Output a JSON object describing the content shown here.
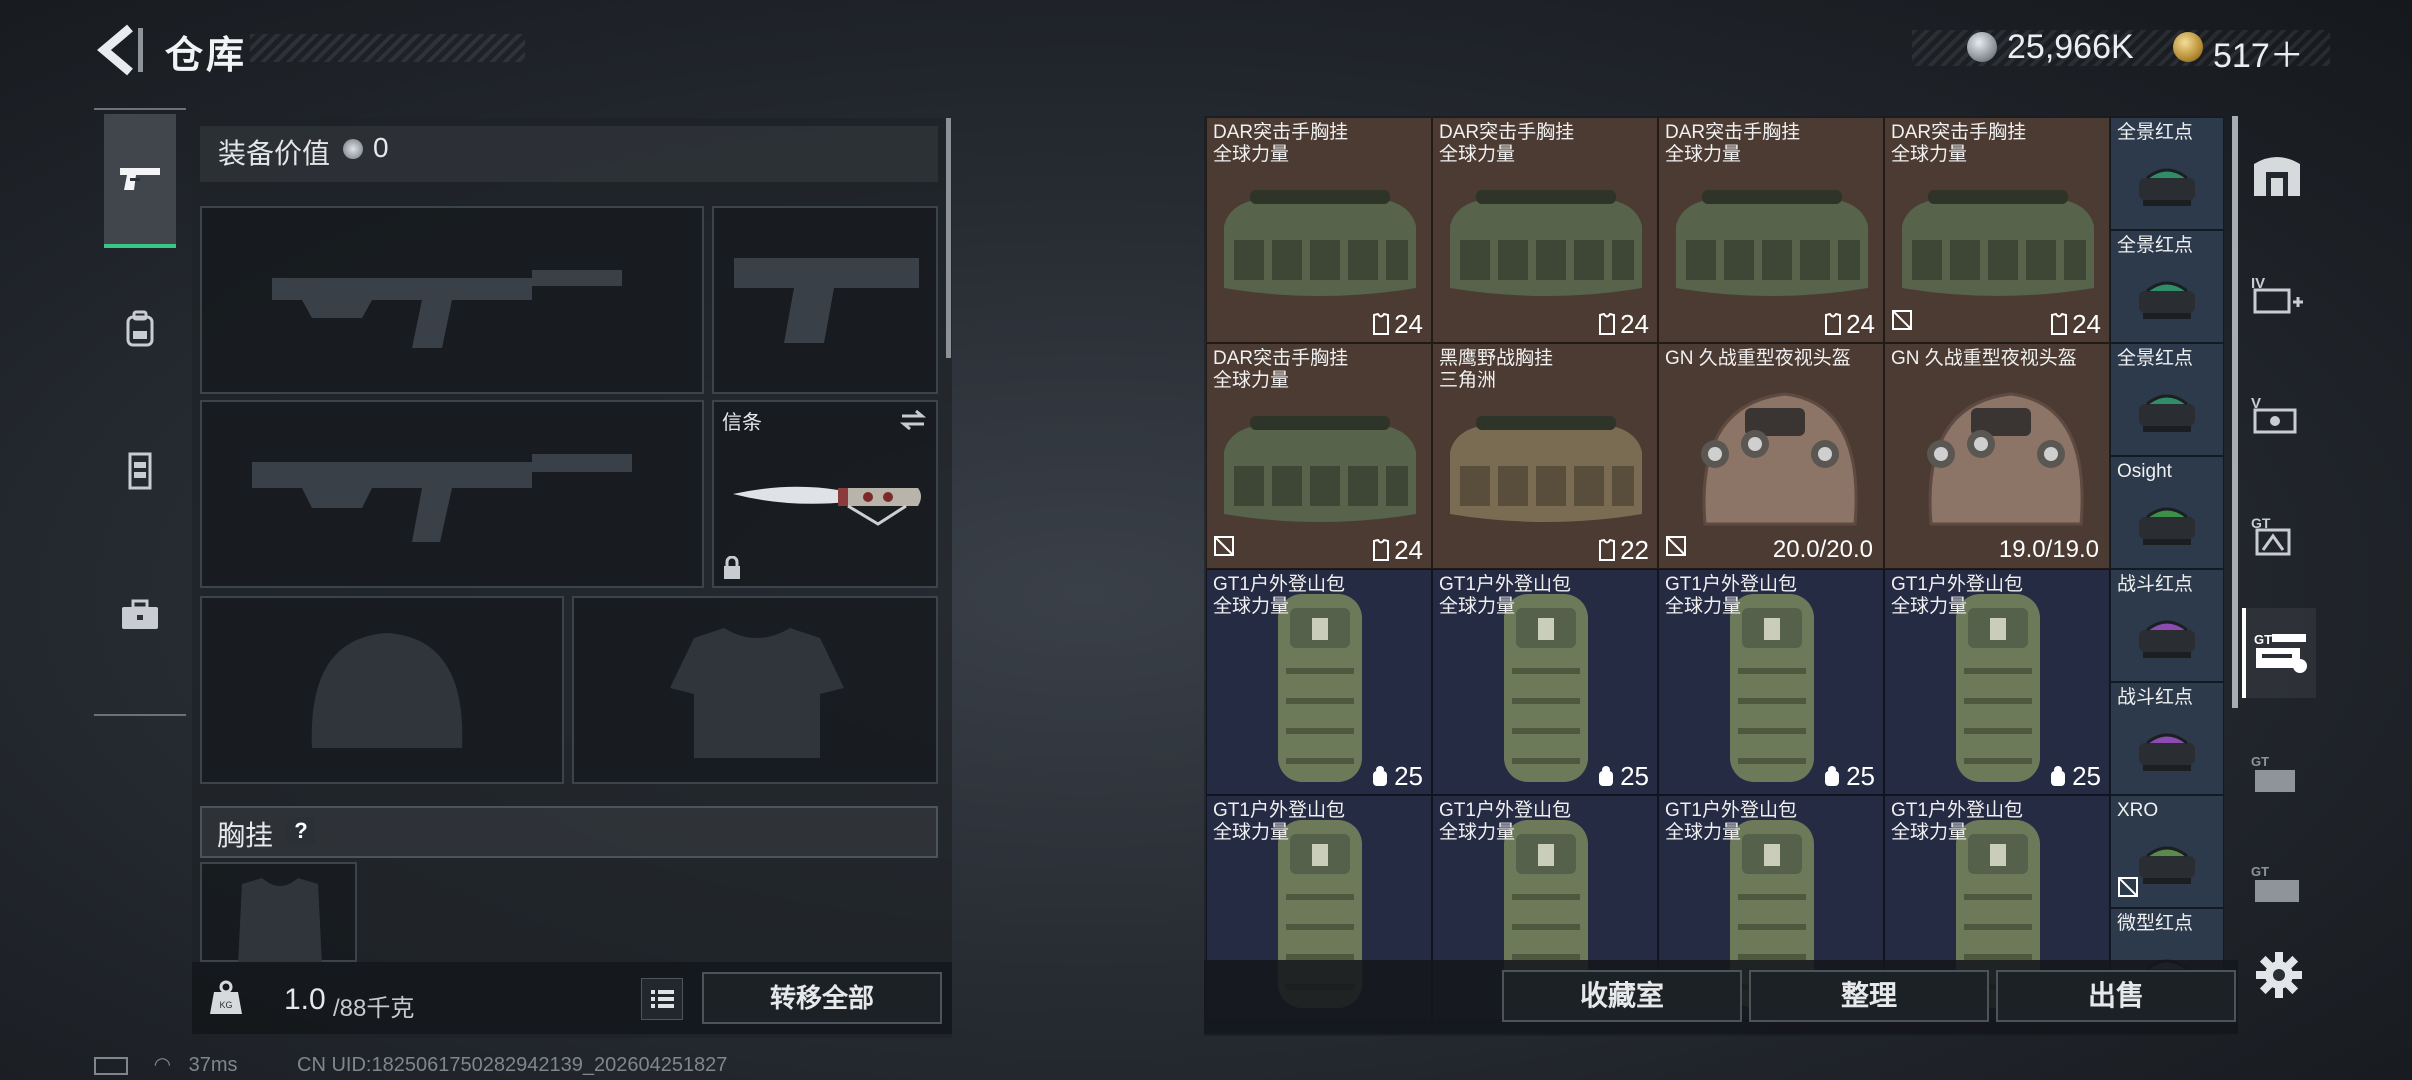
{
  "header": {
    "title": "仓库"
  },
  "currency": {
    "coin": "25,966K",
    "gem": "517＋"
  },
  "left_nav": {
    "items": [
      "weapon-tab",
      "backpack-tab",
      "vest-tab",
      "toolbox-tab"
    ],
    "active": 0
  },
  "equipment": {
    "value_label": "装备价值",
    "value": "0",
    "pouch_slot_label": "信条",
    "chest_label": "胸挂",
    "chest_help": "?"
  },
  "weight": {
    "current": "1.0",
    "max": "/88千克"
  },
  "buttons": {
    "transfer_all": "转移全部",
    "collection": "收藏室",
    "organize": "整理",
    "sell": "出售"
  },
  "stash_grid": {
    "rows": [
      [
        {
          "name": "DAR突击手胸挂\n全球力量",
          "count": "24",
          "bg": "brown",
          "type": "vest",
          "tag": false
        },
        {
          "name": "DAR突击手胸挂\n全球力量",
          "count": "24",
          "bg": "brown",
          "type": "vest",
          "tag": false
        },
        {
          "name": "DAR突击手胸挂\n全球力量",
          "count": "24",
          "bg": "brown",
          "type": "vest",
          "tag": false
        },
        {
          "name": "DAR突击手胸挂\n全球力量",
          "count": "24",
          "bg": "brown",
          "type": "vest",
          "tag": true
        }
      ],
      [
        {
          "name": "DAR突击手胸挂\n全球力量",
          "count": "24",
          "bg": "brown",
          "type": "vest",
          "tag": true
        },
        {
          "name": "黑鹰野战胸挂\n三角洲",
          "count": "22",
          "bg": "brown",
          "type": "vest2",
          "tag": false
        },
        {
          "name": "GN 久战重型夜视头盔",
          "durability": "20.0/20.0",
          "bg": "brown",
          "type": "helmet",
          "tag": true
        },
        {
          "name": "GN 久战重型夜视头盔",
          "durability": "19.0/19.0",
          "bg": "brown",
          "type": "helmet",
          "tag": false
        }
      ],
      [
        {
          "name": "GT1户外登山包\n全球力量",
          "count": "25",
          "bg": "blue",
          "type": "pack",
          "tag": false
        },
        {
          "name": "GT1户外登山包\n全球力量",
          "count": "25",
          "bg": "blue",
          "type": "pack",
          "tag": false
        },
        {
          "name": "GT1户外登山包\n全球力量",
          "count": "25",
          "bg": "blue",
          "type": "pack",
          "tag": false
        },
        {
          "name": "GT1户外登山包\n全球力量",
          "count": "25",
          "bg": "blue",
          "type": "pack",
          "tag": false
        }
      ],
      [
        {
          "name": "GT1户外登山包\n全球力量",
          "count": "",
          "bg": "blue",
          "type": "pack",
          "tag": false
        },
        {
          "name": "GT1户外登山包\n全球力量",
          "count": "",
          "bg": "blue",
          "type": "pack",
          "tag": false
        },
        {
          "name": "GT1户外登山包\n全球力量",
          "count": "",
          "bg": "blue",
          "type": "pack",
          "tag": false
        },
        {
          "name": "GT1户外登山包\n全球力量",
          "count": "",
          "bg": "blue",
          "type": "pack",
          "tag": false
        }
      ]
    ],
    "side_items": [
      {
        "name": "全景红点",
        "color": "#2f8d6a"
      },
      {
        "name": "全景红点",
        "color": "#2f8d6a"
      },
      {
        "name": "全景红点",
        "color": "#2f8d6a"
      },
      {
        "name": "Osight",
        "color": "#3d8f4a"
      },
      {
        "name": "战斗红点",
        "color": "#8b4bb0"
      },
      {
        "name": "战斗红点",
        "color": "#8b4bb0"
      },
      {
        "name": "XRO",
        "color": "#5a8a4c",
        "tag": true
      },
      {
        "name": "微型红点",
        "color": "#4d6e7a"
      }
    ]
  },
  "right_nav": {
    "items": [
      "safebox",
      "IV+",
      "V",
      "GT",
      "GT",
      "GT",
      "GT"
    ],
    "active": 4
  },
  "status": {
    "ping": "37ms",
    "uid": "CN UID:1825061750282942139_202604251827"
  }
}
